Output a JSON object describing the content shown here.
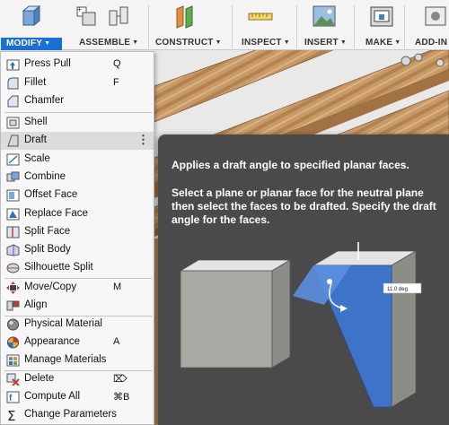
{
  "toolbar": {
    "groups": [
      {
        "label": "MODIFY",
        "active": true
      },
      {
        "label": "ASSEMBLE"
      },
      {
        "label": "CONSTRUCT"
      },
      {
        "label": "INSPECT"
      },
      {
        "label": "INSERT"
      },
      {
        "label": "MAKE"
      },
      {
        "label": "ADD-IN"
      }
    ],
    "caret": "▼",
    "accent": "#1a6fd6"
  },
  "menu": {
    "items": [
      {
        "label": "Press Pull",
        "shortcut": "Q",
        "icon": "press-pull-icon"
      },
      {
        "label": "Fillet",
        "shortcut": "F",
        "icon": "fillet-icon"
      },
      {
        "label": "Chamfer",
        "shortcut": "",
        "icon": "chamfer-icon"
      },
      {
        "label": "Shell",
        "shortcut": "",
        "icon": "shell-icon"
      },
      {
        "label": "Draft",
        "shortcut": "",
        "icon": "draft-icon",
        "highlighted": true,
        "more": "⋮"
      },
      {
        "label": "Scale",
        "shortcut": "",
        "icon": "scale-icon"
      },
      {
        "label": "Combine",
        "shortcut": "",
        "icon": "combine-icon"
      },
      {
        "label": "Offset Face",
        "shortcut": "",
        "icon": "offset-face-icon"
      },
      {
        "label": "Replace Face",
        "shortcut": "",
        "icon": "replace-face-icon"
      },
      {
        "label": "Split Face",
        "shortcut": "",
        "icon": "split-face-icon"
      },
      {
        "label": "Split Body",
        "shortcut": "",
        "icon": "split-body-icon"
      },
      {
        "label": "Silhouette Split",
        "shortcut": "",
        "icon": "silhouette-split-icon"
      },
      {
        "label": "Move/Copy",
        "shortcut": "M",
        "icon": "move-copy-icon"
      },
      {
        "label": "Align",
        "shortcut": "",
        "icon": "align-icon"
      },
      {
        "label": "Physical Material",
        "shortcut": "",
        "icon": "physical-material-icon"
      },
      {
        "label": "Appearance",
        "shortcut": "A",
        "icon": "appearance-icon"
      },
      {
        "label": "Manage Materials",
        "shortcut": "",
        "icon": "manage-materials-icon"
      },
      {
        "label": "Delete",
        "shortcut": "⌦",
        "icon": "delete-icon"
      },
      {
        "label": "Compute All",
        "shortcut": "⌘B",
        "icon": "compute-all-icon"
      },
      {
        "label": "Change Parameters",
        "shortcut": "",
        "icon": "change-parameters-icon"
      }
    ]
  },
  "tooltip": {
    "title": "Applies a draft angle to specified planar faces.",
    "description": "Select a plane or planar face for the neutral plane then select the faces to be drafted. Specify the draft angle for the faces.",
    "angle_readout": "11.0 deg"
  }
}
